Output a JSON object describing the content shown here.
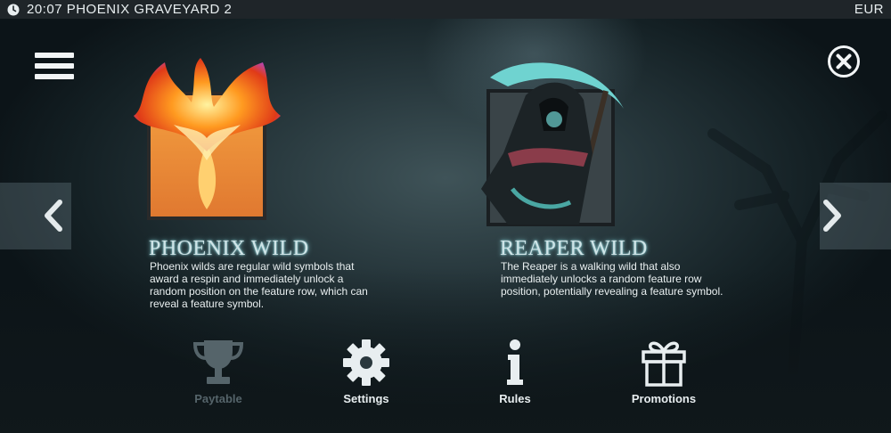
{
  "status_bar": {
    "time": "20:07",
    "game_title": "PHOENIX GRAVEYARD 2",
    "currency": "EUR"
  },
  "features": [
    {
      "title": "PHOENIX WILD",
      "lines": [
        "Phoenix wilds are regular wild symbols that",
        "award a respin and immediately unlock a",
        "random position on the feature row, which can",
        "reveal a feature symbol."
      ]
    },
    {
      "title": "REAPER WILD",
      "lines": [
        "The Reaper is a walking wild that also",
        "immediately unlocks a random feature row",
        "position, potentially revealing a feature symbol."
      ]
    }
  ],
  "bottom_nav": [
    {
      "label": "Paytable",
      "icon": "trophy-icon",
      "enabled": false
    },
    {
      "label": "Settings",
      "icon": "gear-icon",
      "enabled": true
    },
    {
      "label": "Rules",
      "icon": "info-icon",
      "enabled": true
    },
    {
      "label": "Promotions",
      "icon": "gift-icon",
      "enabled": true
    }
  ],
  "icons": {
    "menu": "hamburger-menu-icon",
    "close": "close-icon",
    "prev": "chevron-left-icon",
    "next": "chevron-right-icon",
    "clock": "clock-icon"
  },
  "colors": {
    "status_bar_bg": "#1f2529",
    "title_glow": "#9fe3ea",
    "disabled_nav": "#55646a",
    "icon_light": "#e8eef0"
  }
}
